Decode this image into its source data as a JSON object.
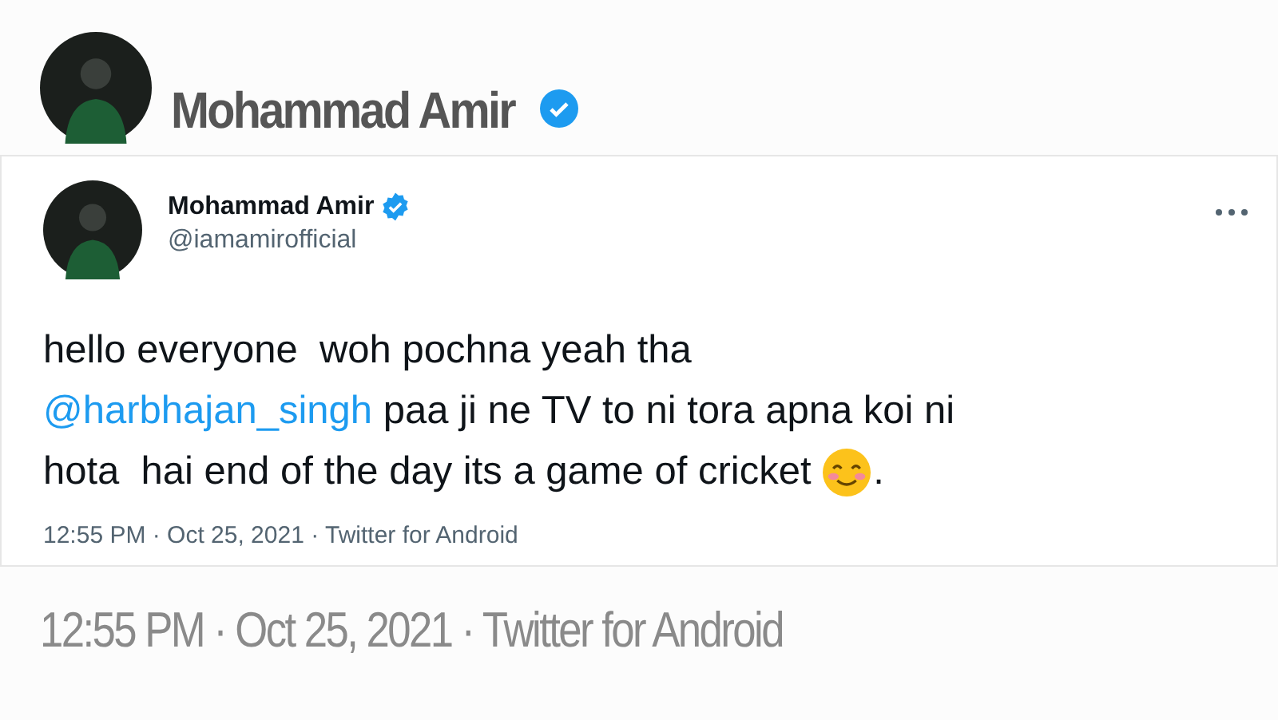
{
  "background": {
    "author_name": "Mohammad Amir",
    "verified": true,
    "timestamp": "12:55 PM · Oct 25, 2021 · Twitter for Android"
  },
  "tweet": {
    "author_name": "Mohammad Amir",
    "verified": true,
    "handle": "@iamamirofficial",
    "lines": [
      [
        {
          "kind": "text",
          "text": "hello everyone  woh pochna yeah tha"
        }
      ],
      [
        {
          "kind": "mention",
          "text": "@harbhajan_singh"
        },
        {
          "kind": "text",
          "text": " paa ji ne TV to ni tora apna koi ni"
        }
      ],
      [
        {
          "kind": "text",
          "text": "hota  hai end of the day its a game of cricket "
        },
        {
          "kind": "emoji"
        },
        {
          "kind": "text",
          "text": "."
        }
      ]
    ],
    "timestamp": "12:55 PM · Oct 25, 2021 · Twitter for Android"
  }
}
